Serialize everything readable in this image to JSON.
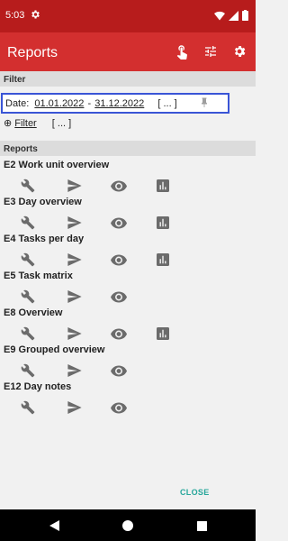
{
  "status_bar": {
    "time": "5:03"
  },
  "app_bar": {
    "title": "Reports"
  },
  "filter_section": {
    "header": "Filter",
    "date_label": "Date:",
    "date_from": "01.01.2022",
    "date_sep": "-",
    "date_to": "31.12.2022",
    "date_more": "[ ... ]",
    "filter_prefix": "⊕",
    "filter_link": "Filter",
    "filter_more": "[ ... ]"
  },
  "reports_section": {
    "header": "Reports",
    "items": [
      {
        "title": "E2 Work unit overview",
        "has_chart": true
      },
      {
        "title": "E3 Day overview",
        "has_chart": true
      },
      {
        "title": "E4 Tasks per day",
        "has_chart": true
      },
      {
        "title": "E5 Task matrix",
        "has_chart": false
      },
      {
        "title": "E8 Overview",
        "has_chart": true
      },
      {
        "title": "E9 Grouped overview",
        "has_chart": false
      },
      {
        "title": "E12 Day notes",
        "has_chart": false
      }
    ]
  },
  "footer": {
    "close_label": "CLOSE"
  },
  "colors": {
    "status_bar": "#b71c1c",
    "app_bar": "#d32f2f",
    "highlight_border": "#3a55d6",
    "close_text": "#26a69a",
    "icon_gray": "#6b6b6b"
  },
  "icons": {
    "status": [
      "gear-icon",
      "wifi-icon",
      "signal-icon",
      "battery-icon"
    ],
    "app_bar": [
      "touch-icon",
      "tune-icon",
      "settings-icon"
    ],
    "report_row": [
      "wrench-icon",
      "send-icon",
      "eye-icon",
      "bar-chart-icon"
    ],
    "nav": [
      "back-icon",
      "home-icon",
      "recents-icon"
    ]
  }
}
